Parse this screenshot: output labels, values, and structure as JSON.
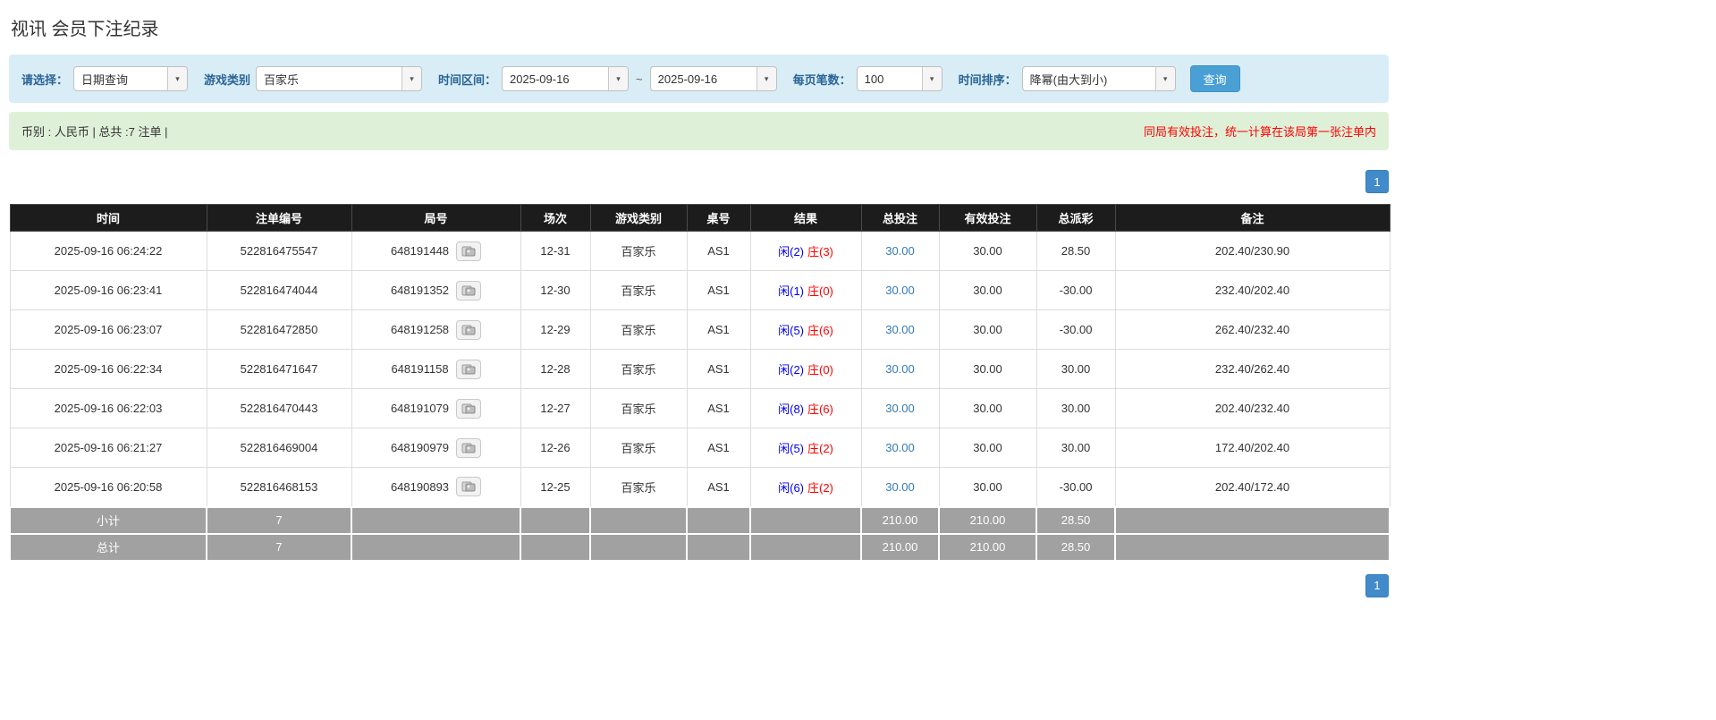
{
  "page": {
    "title": "视讯 会员下注纪录"
  },
  "filters": {
    "select_label": "请选择：",
    "select_value": "日期查询",
    "game_type_label": "游戏类别",
    "game_type_value": "百家乐",
    "time_range_label": "时间区间：",
    "time_from": "2025-09-16",
    "tilde": "~",
    "time_to": "2025-09-16",
    "page_size_label": "每页笔数：",
    "page_size_value": "100",
    "sort_label": "时间排序：",
    "sort_value": "降幂(由大到小)",
    "search_button": "查询"
  },
  "info_bar": {
    "left": "币别 : 人民币 | 总共 :7 注单 |",
    "right": "同局有效投注，统一计算在该局第一张注单内"
  },
  "pagination": {
    "page": "1"
  },
  "table": {
    "headers": [
      "时间",
      "注单编号",
      "局号",
      "场次",
      "游戏类别",
      "桌号",
      "结果",
      "总投注",
      "有效投注",
      "总派彩",
      "备注"
    ],
    "rows": [
      {
        "time": "2025-09-16 06:24:22",
        "bet_id": "522816475547",
        "round_id": "648191448",
        "session": "12-31",
        "game": "百家乐",
        "table_no": "AS1",
        "player": "闲(2)",
        "banker": "庄(3)",
        "total_bet": "30.00",
        "valid_bet": "30.00",
        "payout": "28.50",
        "note": "202.40/230.90"
      },
      {
        "time": "2025-09-16 06:23:41",
        "bet_id": "522816474044",
        "round_id": "648191352",
        "session": "12-30",
        "game": "百家乐",
        "table_no": "AS1",
        "player": "闲(1)",
        "banker": "庄(0)",
        "total_bet": "30.00",
        "valid_bet": "30.00",
        "payout": "-30.00",
        "note": "232.40/202.40"
      },
      {
        "time": "2025-09-16 06:23:07",
        "bet_id": "522816472850",
        "round_id": "648191258",
        "session": "12-29",
        "game": "百家乐",
        "table_no": "AS1",
        "player": "闲(5)",
        "banker": "庄(6)",
        "total_bet": "30.00",
        "valid_bet": "30.00",
        "payout": "-30.00",
        "note": "262.40/232.40"
      },
      {
        "time": "2025-09-16 06:22:34",
        "bet_id": "522816471647",
        "round_id": "648191158",
        "session": "12-28",
        "game": "百家乐",
        "table_no": "AS1",
        "player": "闲(2)",
        "banker": "庄(0)",
        "total_bet": "30.00",
        "valid_bet": "30.00",
        "payout": "30.00",
        "note": "232.40/262.40"
      },
      {
        "time": "2025-09-16 06:22:03",
        "bet_id": "522816470443",
        "round_id": "648191079",
        "session": "12-27",
        "game": "百家乐",
        "table_no": "AS1",
        "player": "闲(8)",
        "banker": "庄(6)",
        "total_bet": "30.00",
        "valid_bet": "30.00",
        "payout": "30.00",
        "note": "202.40/232.40"
      },
      {
        "time": "2025-09-16 06:21:27",
        "bet_id": "522816469004",
        "round_id": "648190979",
        "session": "12-26",
        "game": "百家乐",
        "table_no": "AS1",
        "player": "闲(5)",
        "banker": "庄(2)",
        "total_bet": "30.00",
        "valid_bet": "30.00",
        "payout": "30.00",
        "note": "172.40/202.40"
      },
      {
        "time": "2025-09-16 06:20:58",
        "bet_id": "522816468153",
        "round_id": "648190893",
        "session": "12-25",
        "game": "百家乐",
        "table_no": "AS1",
        "player": "闲(6)",
        "banker": "庄(2)",
        "total_bet": "30.00",
        "valid_bet": "30.00",
        "payout": "-30.00",
        "note": "202.40/172.40"
      }
    ],
    "subtotal": {
      "label": "小计",
      "count": "7",
      "total_bet": "210.00",
      "valid_bet": "210.00",
      "payout": "28.50"
    },
    "total": {
      "label": "总计",
      "count": "7",
      "total_bet": "210.00",
      "valid_bet": "210.00",
      "payout": "28.50"
    }
  }
}
